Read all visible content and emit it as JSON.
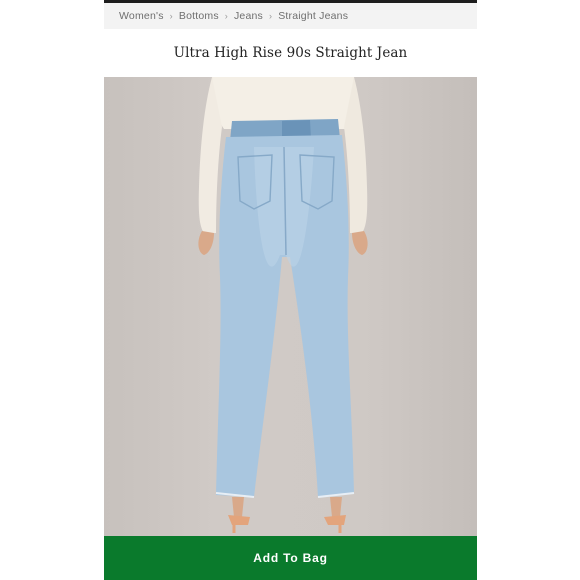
{
  "breadcrumb": {
    "items": [
      "Women's",
      "Bottoms",
      "Jeans",
      "Straight Jeans"
    ],
    "separator": "›"
  },
  "product": {
    "title": "Ultra High Rise 90s Straight Jean",
    "image_alt": "Back view of model wearing light wash straight jeans and a white long-sleeve top"
  },
  "actions": {
    "add_to_bag": "Add To Bag"
  },
  "colors": {
    "button": "#0a7a2c",
    "denim": "#a9c6df"
  }
}
